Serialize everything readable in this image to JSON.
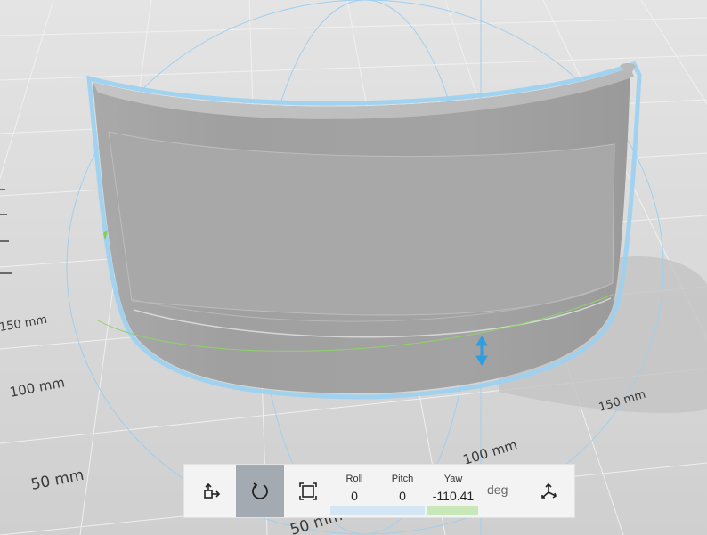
{
  "scale_labels": {
    "mm_50_left": "50 mm",
    "mm_100_left": "100 mm",
    "mm_150_left": "150 mm",
    "mm_150_right": "150 mm",
    "mm_100_bottom": "100 mm",
    "mm_50_bottom": "50 mm"
  },
  "toolbar": {
    "roll_label": "Roll",
    "roll_value": "0",
    "pitch_label": "Pitch",
    "pitch_value": "0",
    "yaw_label": "Yaw",
    "yaw_value": "-110.41",
    "unit": "deg",
    "active_tool": "rotate"
  },
  "icons": {
    "move": "move-icon",
    "rotate": "rotate-icon",
    "scale": "scale-icon",
    "axes": "axes-icon"
  },
  "colors": {
    "selection_outline": "#7fc4ef",
    "gizmo_blue": "#2f9ee0",
    "gizmo_green": "#8fd36a",
    "active_button": "#a4aab1",
    "yaw_bar": "#c9e8b9",
    "roll_bar": "#d4e6f4"
  }
}
